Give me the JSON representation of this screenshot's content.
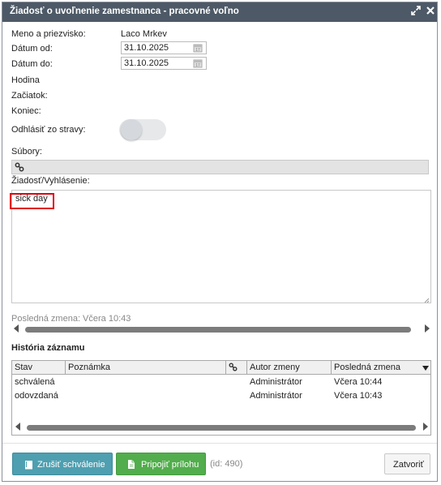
{
  "dialog": {
    "title": "Žiadosť o uvoľnenie zamestnanca - pracovné voľno"
  },
  "form": {
    "name_label": "Meno a priezvisko:",
    "name_value": "Laco Mrkev",
    "date_from_label": "Dátum od:",
    "date_from_value": "31.10.2025",
    "date_to_label": "Dátum do:",
    "date_to_value": "31.10.2025",
    "hour_label": "Hodina",
    "start_label": "Začiatok:",
    "end_label": "Koniec:",
    "meal_label": "Odhlásiť zo stravy:",
    "files_label": "Súbory:",
    "request_label": "Žiadosť/Vyhlásenie:",
    "request_text": "sick day",
    "last_change": "Posledná zmena: Včera 10:43"
  },
  "history": {
    "title": "História záznamu",
    "columns": [
      "Stav",
      "Poznámka",
      "Autor zmeny",
      "Posledná zmena"
    ],
    "rows": [
      {
        "status": "schválená",
        "note": "",
        "author": "Administrátor",
        "changed": "Včera 10:44"
      },
      {
        "status": "odovzdaná",
        "note": "",
        "author": "Administrátor",
        "changed": "Včera 10:43"
      }
    ]
  },
  "footer": {
    "cancel_approval": "Zrušiť schválenie",
    "attach": "Pripojiť prílohu",
    "id_text": "(id: 490)",
    "close": "Zatvoriť"
  },
  "colors": {
    "titlebar": "#4d5966",
    "teal_button": "#4e9fb0",
    "green_button": "#52ad4c",
    "highlight": "#e0000f"
  }
}
